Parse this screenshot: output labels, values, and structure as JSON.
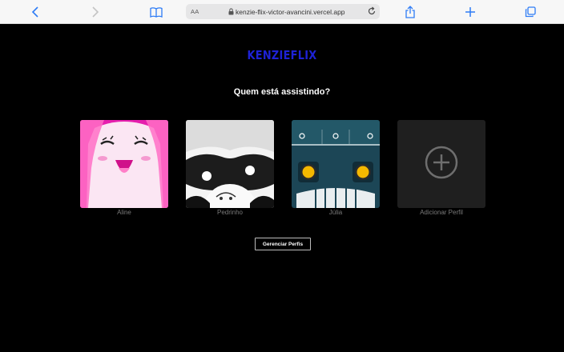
{
  "browser": {
    "aa_label": "AA",
    "url": "kenzie-flix-victor-avancini.vercel.app"
  },
  "app": {
    "logo": "KENZIEFLIX",
    "heading": "Quem está assistindo?",
    "profiles": [
      {
        "name": "Aline"
      },
      {
        "name": "Pedrinho"
      },
      {
        "name": "Júlia"
      }
    ],
    "add_profile_label": "Adicionar Perfil",
    "manage_button": "Gerenciar Perfis"
  },
  "colors": {
    "logo": "#1e22d6",
    "toolbar_accent": "#2e7cf6"
  }
}
